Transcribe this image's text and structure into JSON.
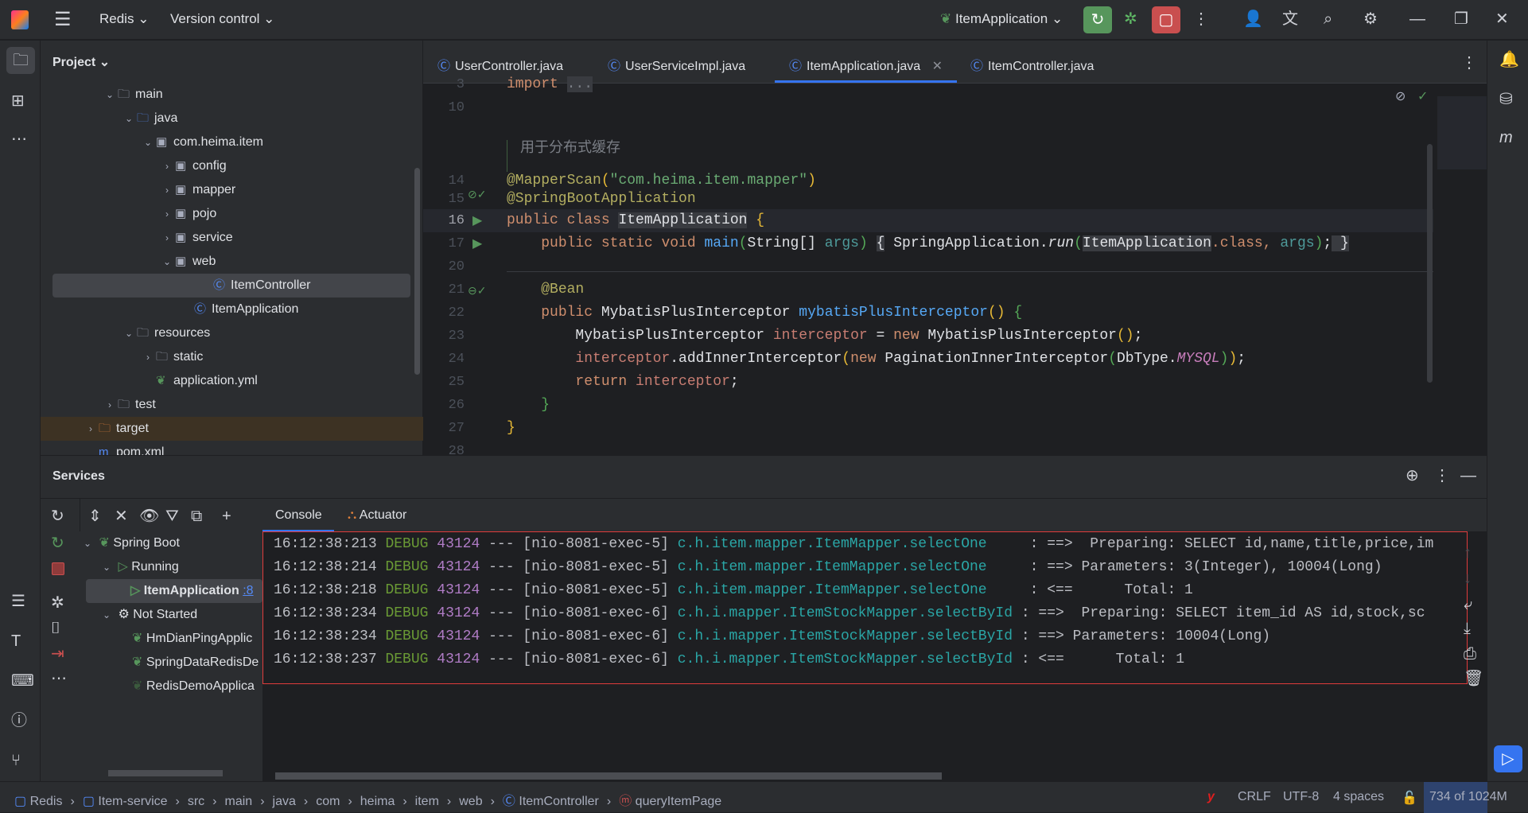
{
  "titlebar": {
    "project": "Redis",
    "vcs": "Version control",
    "run_config": "ItemApplication"
  },
  "project_panel": {
    "title": "Project",
    "tree": [
      {
        "label": "main",
        "indent": 3,
        "type": "folder",
        "open": true
      },
      {
        "label": "java",
        "indent": 4,
        "type": "folder-blue",
        "open": true
      },
      {
        "label": "com.heima.item",
        "indent": 5,
        "type": "package",
        "open": true
      },
      {
        "label": "config",
        "indent": 6,
        "type": "package",
        "open": false
      },
      {
        "label": "mapper",
        "indent": 6,
        "type": "package",
        "open": false
      },
      {
        "label": "pojo",
        "indent": 6,
        "type": "package",
        "open": false
      },
      {
        "label": "service",
        "indent": 6,
        "type": "package",
        "open": false
      },
      {
        "label": "web",
        "indent": 6,
        "type": "package",
        "open": true
      },
      {
        "label": "ItemController",
        "indent": 8,
        "type": "class",
        "selected": true
      },
      {
        "label": "ItemApplication",
        "indent": 7,
        "type": "spring-class"
      },
      {
        "label": "resources",
        "indent": 4,
        "type": "folder",
        "open": true
      },
      {
        "label": "static",
        "indent": 5,
        "type": "folder",
        "open": false
      },
      {
        "label": "application.yml",
        "indent": 5,
        "type": "yml"
      },
      {
        "label": "test",
        "indent": 3,
        "type": "folder",
        "open": false
      },
      {
        "label": "target",
        "indent": 2,
        "type": "folder-orange",
        "open": false
      },
      {
        "label": "pom.xml",
        "indent": 2,
        "type": "maven"
      }
    ]
  },
  "editor": {
    "tabs": [
      {
        "label": "UserController.java"
      },
      {
        "label": "UserServiceImpl.java"
      },
      {
        "label": "ItemApplication.java",
        "active": true
      },
      {
        "label": "ItemController.java"
      }
    ],
    "line_numbers": [
      "3",
      "10",
      "",
      "14",
      "15",
      "16",
      "17",
      "20",
      "21",
      "22",
      "23",
      "24",
      "25",
      "26",
      "27",
      "28"
    ],
    "comment": "用于分布式缓存",
    "tokens": {
      "import": "import",
      "ellipsis": "...",
      "mapperscan": "@MapperScan",
      "pkg": "\"com.heima.item.mapper\"",
      "sba": "@SpringBootApplication",
      "public": "public",
      "class": "class",
      "static": "static",
      "void": "void",
      "new": "new",
      "return": "return",
      "classname": "ItemApplication",
      "main": "main",
      "string": "String[]",
      "args": "args",
      "springapp": "SpringApplication.",
      "run": "run",
      "dotclass": ".class, ",
      "bean": "@Bean",
      "mpi": "MybatisPlusInterceptor",
      "mpim": "mybatisPlusInterceptor",
      "interceptor": "interceptor",
      "add": ".addInnerInterceptor",
      "pii": "PaginationInnerInterceptor",
      "dbtype": "DbType.",
      "mysql": "MYSQL"
    }
  },
  "services": {
    "title": "Services",
    "tabs": [
      "Console",
      "Actuator"
    ],
    "tree": [
      {
        "label": "Spring Boot"
      },
      {
        "label": "Running"
      },
      {
        "label": "ItemApplication",
        "port": ":8"
      },
      {
        "label": "Not Started"
      },
      {
        "label": "HmDianPingApplic"
      },
      {
        "label": "SpringDataRedisDe"
      },
      {
        "label": "RedisDemoApplica"
      }
    ],
    "log": [
      {
        "time": "16:12:38:213",
        "level": "DEBUG",
        "pid": "43124",
        "thread": "--- [nio-8081-exec-5]",
        "logger": "c.h.item.mapper.ItemMapper.selectOne    ",
        "msg": " : ==>  Preparing: SELECT id,name,title,price,im"
      },
      {
        "time": "16:12:38:214",
        "level": "DEBUG",
        "pid": "43124",
        "thread": "--- [nio-8081-exec-5]",
        "logger": "c.h.item.mapper.ItemMapper.selectOne    ",
        "msg": " : ==> Parameters: 3(Integer), 10004(Long)"
      },
      {
        "time": "16:12:38:218",
        "level": "DEBUG",
        "pid": "43124",
        "thread": "--- [nio-8081-exec-5]",
        "logger": "c.h.item.mapper.ItemMapper.selectOne    ",
        "msg": " : <==      Total: 1"
      },
      {
        "time": "16:12:38:234",
        "level": "DEBUG",
        "pid": "43124",
        "thread": "--- [nio-8081-exec-6]",
        "logger": "c.h.i.mapper.ItemStockMapper.selectById",
        "msg": " : ==>  Preparing: SELECT item_id AS id,stock,sc"
      },
      {
        "time": "16:12:38:234",
        "level": "DEBUG",
        "pid": "43124",
        "thread": "--- [nio-8081-exec-6]",
        "logger": "c.h.i.mapper.ItemStockMapper.selectById",
        "msg": " : ==> Parameters: 10004(Long)"
      },
      {
        "time": "16:12:38:237",
        "level": "DEBUG",
        "pid": "43124",
        "thread": "--- [nio-8081-exec-6]",
        "logger": "c.h.i.mapper.ItemStockMapper.selectById",
        "msg": " : <==      Total: 1"
      }
    ]
  },
  "statusbar": {
    "breadcrumb": [
      "Redis",
      "Item-service",
      "src",
      "main",
      "java",
      "com",
      "heima",
      "item",
      "web",
      "ItemController",
      "queryItemPage"
    ],
    "line_sep": "CRLF",
    "encoding": "UTF-8",
    "indent": "4 spaces",
    "memory": "734 of 1024M"
  },
  "colors": {
    "accent": "#3574f0",
    "run_green": "#57965c",
    "stop_red": "#c94f4f",
    "highlight_border": "#e03c3c"
  }
}
